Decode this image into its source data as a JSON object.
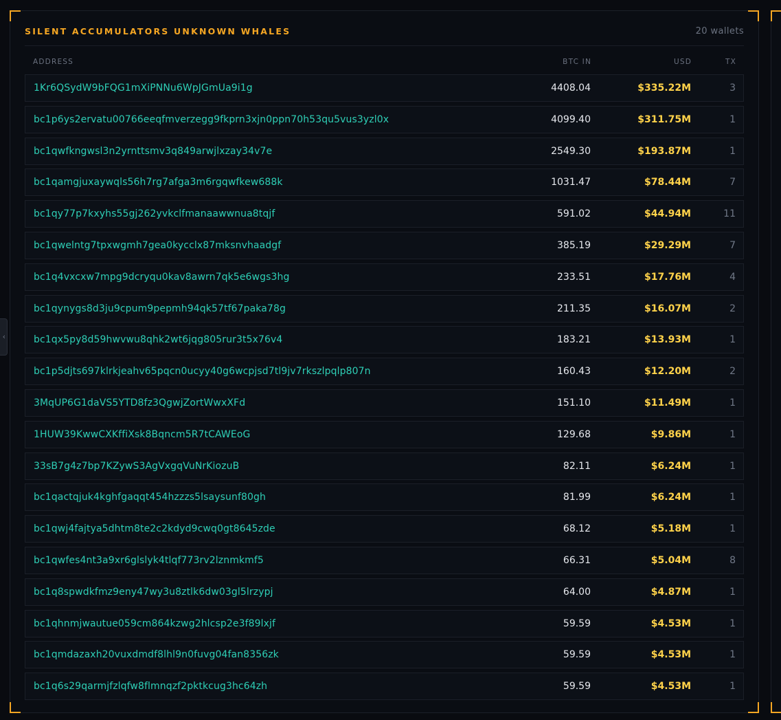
{
  "panel": {
    "title": "SILENT ACCUMULATORS UNKNOWN WHALES",
    "count": "20 wallets",
    "accent_color": "#f5a623"
  },
  "columns": {
    "address": "ADDRESS",
    "btc": "BTC IN",
    "usd": "USD",
    "tx": "TX"
  },
  "side_tab": {
    "icon": "chevron-left-icon",
    "glyph": "‹"
  },
  "rows": [
    {
      "address": "1Kr6QSydW9bFQG1mXiPNNu6WpJGmUa9i1g",
      "btc": "4408.04",
      "usd": "$335.22M",
      "tx": "3"
    },
    {
      "address": "bc1p6ys2ervatu00766eeqfmverzegg9fkprn3xjn0ppn70h53qu5vus3yzl0x",
      "btc": "4099.40",
      "usd": "$311.75M",
      "tx": "1"
    },
    {
      "address": "bc1qwfkngwsl3n2yrnttsmv3q849arwjlxzay34v7e",
      "btc": "2549.30",
      "usd": "$193.87M",
      "tx": "1"
    },
    {
      "address": "bc1qamgjuxaywqls56h7rg7afga3m6rgqwfkew688k",
      "btc": "1031.47",
      "usd": "$78.44M",
      "tx": "7"
    },
    {
      "address": "bc1qy77p7kxyhs55gj262yvkclfmanaawwnua8tqjf",
      "btc": "591.02",
      "usd": "$44.94M",
      "tx": "11"
    },
    {
      "address": "bc1qwelntg7tpxwgmh7gea0kycclx87mksnvhaadgf",
      "btc": "385.19",
      "usd": "$29.29M",
      "tx": "7"
    },
    {
      "address": "bc1q4vxcxw7mpg9dcryqu0kav8awrn7qk5e6wgs3hg",
      "btc": "233.51",
      "usd": "$17.76M",
      "tx": "4"
    },
    {
      "address": "bc1qynygs8d3ju9cpum9pepmh94qk57tf67paka78g",
      "btc": "211.35",
      "usd": "$16.07M",
      "tx": "2"
    },
    {
      "address": "bc1qx5py8d59hwvwu8qhk2wt6jqg805rur3t5x76v4",
      "btc": "183.21",
      "usd": "$13.93M",
      "tx": "1"
    },
    {
      "address": "bc1p5djts697klrkjeahv65pqcn0ucyy40g6wcpjsd7tl9jv7rkszlpqlp807n",
      "btc": "160.43",
      "usd": "$12.20M",
      "tx": "2"
    },
    {
      "address": "3MqUP6G1daVS5YTD8fz3QgwjZortWwxXFd",
      "btc": "151.10",
      "usd": "$11.49M",
      "tx": "1"
    },
    {
      "address": "1HUW39KwwCXKffiXsk8Bqncm5R7tCAWEoG",
      "btc": "129.68",
      "usd": "$9.86M",
      "tx": "1"
    },
    {
      "address": "33sB7g4z7bp7KZywS3AgVxgqVuNrKiozuB",
      "btc": "82.11",
      "usd": "$6.24M",
      "tx": "1"
    },
    {
      "address": "bc1qactqjuk4kghfgaqqt454hzzzs5lsaysunf80gh",
      "btc": "81.99",
      "usd": "$6.24M",
      "tx": "1"
    },
    {
      "address": "bc1qwj4fajtya5dhtm8te2c2kdyd9cwq0gt8645zde",
      "btc": "68.12",
      "usd": "$5.18M",
      "tx": "1"
    },
    {
      "address": "bc1qwfes4nt3a9xr6glslyk4tlqf773rv2lznmkmf5",
      "btc": "66.31",
      "usd": "$5.04M",
      "tx": "8"
    },
    {
      "address": "bc1q8spwdkfmz9eny47wy3u8ztlk6dw03gl5lrzypj",
      "btc": "64.00",
      "usd": "$4.87M",
      "tx": "1"
    },
    {
      "address": "bc1qhnmjwautue059cm864kzwg2hlcsp2e3f89lxjf",
      "btc": "59.59",
      "usd": "$4.53M",
      "tx": "1"
    },
    {
      "address": "bc1qmdazaxh20vuxdmdf8lhl9n0fuvg04fan8356zk",
      "btc": "59.59",
      "usd": "$4.53M",
      "tx": "1"
    },
    {
      "address": "bc1q6s29qarmjfzlqfw8flmnqzf2pktkcug3hc64zh",
      "btc": "59.59",
      "usd": "$4.53M",
      "tx": "1"
    }
  ]
}
